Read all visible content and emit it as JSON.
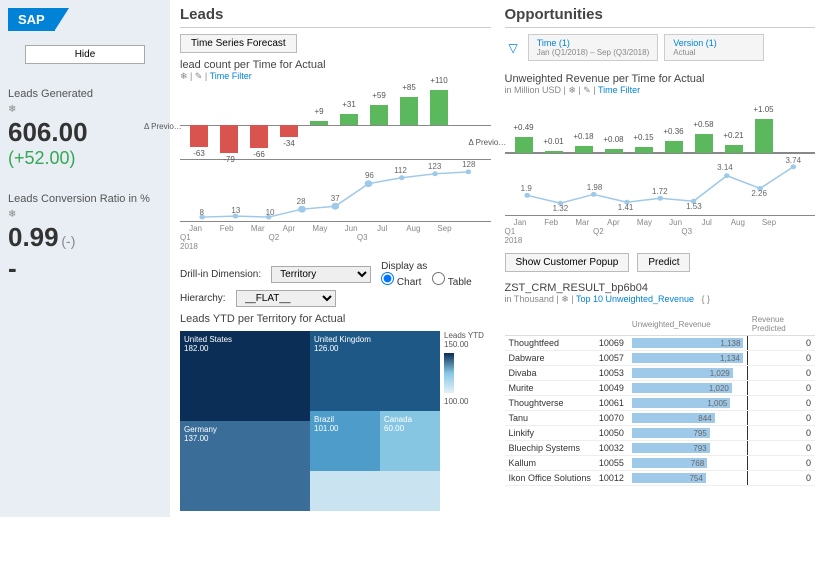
{
  "sidebar": {
    "logo": "SAP",
    "hide_label": "Hide",
    "metrics": [
      {
        "title": "Leads Generated",
        "snow": "❄",
        "value": "606.00",
        "delta": "(+52.00)"
      },
      {
        "title": "Leads Conversion Ratio in %",
        "snow": "❄",
        "value": "0.99",
        "sub": "(-)",
        "dash": "-"
      }
    ]
  },
  "leads": {
    "heading": "Leads",
    "forecast_btn": "Time Series Forecast",
    "chart1_title": "lead count per Time for Actual",
    "chart1_sub_prefix": "❄ | ✎ | ",
    "time_filter": "Time Filter",
    "drill_label": "Drill-in Dimension:",
    "drill_options": [
      "Territory"
    ],
    "hier_label": "Hierarchy:",
    "hier_options": [
      "__FLAT__"
    ],
    "display_as": "Display as",
    "radio_chart": "Chart",
    "radio_table": "Table",
    "tree_title": "Leads YTD per Territory for Actual",
    "tree_legend": "Leads YTD",
    "tree_legend_high": "150.00",
    "tree_legend_low": "100.00",
    "treemap": {
      "us": {
        "name": "United States",
        "value": "182.00"
      },
      "de": {
        "name": "Germany",
        "value": "137.00"
      },
      "uk": {
        "name": "United Kingdom",
        "value": "126.00"
      },
      "br": {
        "name": "Brazil",
        "value": "101.00"
      },
      "ca": {
        "name": "Canada",
        "value": "60.00"
      }
    }
  },
  "opps": {
    "heading": "Opportunities",
    "filter_time_t": "Time (1)",
    "filter_time_s": "Jan (Q1/2018) – Sep (Q3/2018)",
    "filter_ver_t": "Version (1)",
    "filter_ver_s": "Actual",
    "chart1_title": "Unweighted Revenue per Time for Actual",
    "chart1_unit": "in Million USD | ❄ | ✎ | ",
    "time_filter": "Time Filter",
    "popup_btn": "Show Customer Popup",
    "predict_btn": "Predict",
    "table_title": "ZST_CRM_RESULT_bp6b04",
    "table_sub_prefix": "in Thousand | ❄ | ",
    "top10": "Top 10 Unweighted_Revenue",
    "col_rev": "Unweighted_Revenue",
    "col_pred": "Revenue Predicted",
    "expand": "{ }"
  },
  "month_axis": [
    "Jan",
    "Feb",
    "Mar",
    "Apr",
    "May",
    "Jun",
    "Jul",
    "Aug",
    "Sep"
  ],
  "q_axis": "Q1                                   Q2                                   Q3",
  "year": "2018",
  "delta_label": "Δ Previo…",
  "chart_data": {
    "lead_count_delta": {
      "type": "bar",
      "title": "lead count per Time for Actual (Δ Previous)",
      "categories": [
        "Jan",
        "Feb",
        "Mar",
        "Apr",
        "May",
        "Jun",
        "Jul",
        "Aug",
        "Sep"
      ],
      "values": [
        -63,
        -79,
        -66,
        -34,
        9,
        31,
        59,
        85,
        110
      ],
      "ylim": [
        -90,
        120
      ]
    },
    "lead_count_line": {
      "type": "line",
      "categories": [
        "Jan",
        "Feb",
        "Mar",
        "Apr",
        "May",
        "Jun",
        "Jul",
        "Aug",
        "Sep"
      ],
      "values": [
        8,
        13,
        10,
        28,
        37,
        96,
        112,
        123,
        128
      ],
      "ylim": [
        0,
        140
      ]
    },
    "unweighted_rev_delta": {
      "type": "bar",
      "title": "Unweighted Revenue per Time for Actual (Δ Previous)",
      "unit": "Million USD",
      "categories": [
        "Jan",
        "Feb",
        "Mar",
        "Apr",
        "May",
        "Jun",
        "Jul",
        "Aug",
        "Sep"
      ],
      "values": [
        0.49,
        0.01,
        0.18,
        0.08,
        0.15,
        0.36,
        0.58,
        0.21,
        1.05
      ],
      "ylim": [
        0,
        1.1
      ]
    },
    "unweighted_rev_line": {
      "type": "line",
      "unit": "Million USD",
      "categories": [
        "Jan",
        "Feb",
        "Mar",
        "Apr",
        "May",
        "Jun",
        "Jul",
        "Aug",
        "Sep"
      ],
      "values": [
        1.9,
        1.32,
        1.98,
        1.41,
        1.72,
        1.53,
        3.14,
        2.26,
        3.74
      ],
      "ylim": [
        0,
        4
      ]
    },
    "leads_ytd_territory": {
      "type": "treemap",
      "title": "Leads YTD per Territory for Actual",
      "items": [
        {
          "name": "United States",
          "value": 182.0
        },
        {
          "name": "Germany",
          "value": 137.0
        },
        {
          "name": "United Kingdom",
          "value": 126.0
        },
        {
          "name": "Brazil",
          "value": 101.0
        },
        {
          "name": "Canada",
          "value": 60.0
        }
      ]
    },
    "top10_unweighted": {
      "type": "bar",
      "orientation": "horizontal",
      "title": "Top 10 Unweighted_Revenue",
      "unit": "Thousand",
      "rows": [
        {
          "name": "Thoughtfeed",
          "id": 10069,
          "rev": 1138,
          "pred": 0
        },
        {
          "name": "Dabware",
          "id": 10057,
          "rev": 1134,
          "pred": 0
        },
        {
          "name": "Divaba",
          "id": 10053,
          "rev": 1029,
          "pred": 0
        },
        {
          "name": "Murite",
          "id": 10049,
          "rev": 1020,
          "pred": 0
        },
        {
          "name": "Thoughtverse",
          "id": 10061,
          "rev": 1005,
          "pred": 0
        },
        {
          "name": "Tanu",
          "id": 10070,
          "rev": 844,
          "pred": 0
        },
        {
          "name": "Linkify",
          "id": 10050,
          "rev": 795,
          "pred": 0
        },
        {
          "name": "Bluechip Systems",
          "id": 10032,
          "rev": 793,
          "pred": 0
        },
        {
          "name": "Kallum",
          "id": 10055,
          "rev": 768,
          "pred": 0
        },
        {
          "name": "Ikon Office Solutions",
          "id": 10012,
          "rev": 754,
          "pred": 0
        }
      ]
    }
  }
}
